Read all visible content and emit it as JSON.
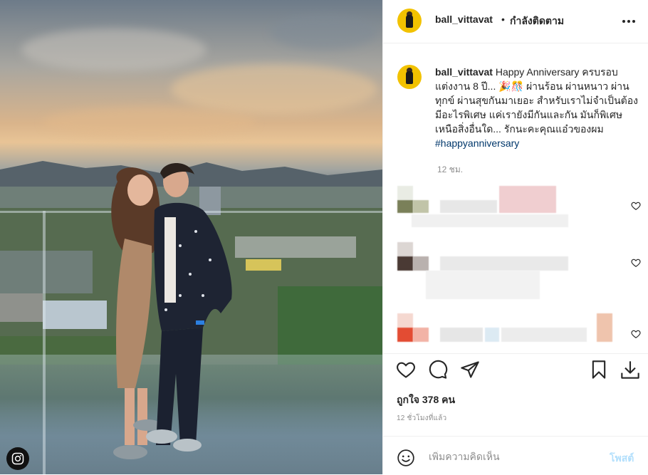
{
  "post": {
    "username": "ball_vittavat",
    "separator": "•",
    "follow_status": "กำลังติดตาม",
    "caption_user": "ball_vittavat",
    "caption_text": "Happy Anniversary ครบรอบแต่งงาน 8 ปี... 🎉🎊 ผ่านร้อน ผ่านหนาว ผ่านทุกข์ ผ่านสุขกันมาเยอะ สำหรับเราไม่จำเป็นต้องมีอะไรพิเศษ แค่เรายังมีกันและกัน มันก็พิเศษเหนือสิ่งอื่นใด... รักนะคะคุณแอ๋วของผม",
    "caption_hashtag": "#happyanniversary",
    "caption_time": "12 ชม.",
    "likes": "ถูกใจ 378 คน",
    "posted_ago": "12 ชั่วโมงที่แล้ว",
    "comment_placeholder": "เพิ่มความคิดเห็น",
    "post_button": "โพสต์"
  },
  "icons": {
    "more": "more-options-icon",
    "like": "heart-icon",
    "comment": "comment-icon",
    "share": "share-icon",
    "save": "bookmark-icon",
    "download": "download-icon",
    "emoji": "emoji-icon",
    "badge": "instagram-icon"
  },
  "colors": {
    "avatar_bg": "#f2c200",
    "hashtag": "#00376b",
    "post_button_disabled": "#b2dffc",
    "muted": "#8e8e8e"
  }
}
